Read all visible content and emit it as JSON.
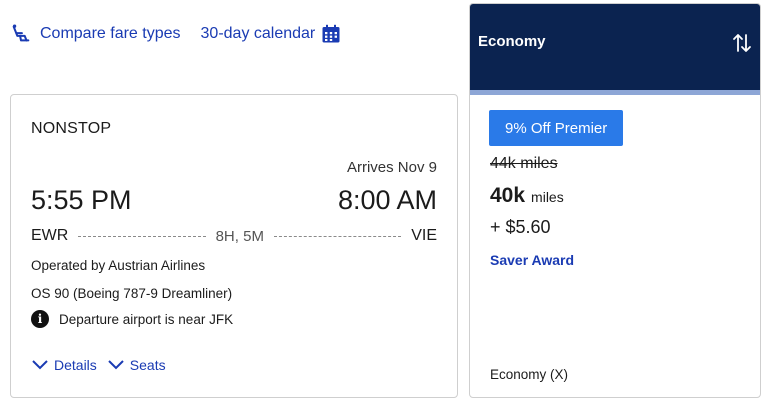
{
  "top_links": {
    "compare_label": "Compare fare types",
    "calendar_label": "30-day calendar",
    "compare_icon": "seat-icon",
    "calendar_icon": "calendar-icon"
  },
  "flight": {
    "stop_type": "NONSTOP",
    "arrives": "Arrives Nov 9",
    "departure_time": "5:55 PM",
    "arrival_time": "8:00 AM",
    "origin": "EWR",
    "destination": "VIE",
    "duration": "8H, 5M",
    "operated_by": "Operated by Austrian Airlines",
    "flight_number": "OS 90 (Boeing 787-9 Dreamliner)",
    "notice": "Departure airport is near JFK",
    "details_label": "Details",
    "seats_label": "Seats"
  },
  "fare": {
    "header_title": "Economy",
    "promo_label": "9% Off Premier",
    "old_miles": "44k miles",
    "miles_value": "40k",
    "miles_unit": "miles",
    "taxes": "+ $5.60",
    "award_type": "Saver Award",
    "fare_class": "Economy (X)"
  },
  "colors": {
    "link": "#1a3bb3",
    "header_bg": "#0b2350",
    "promo_bg": "#2a7ae8",
    "accent_bar": "#8da6d6"
  }
}
